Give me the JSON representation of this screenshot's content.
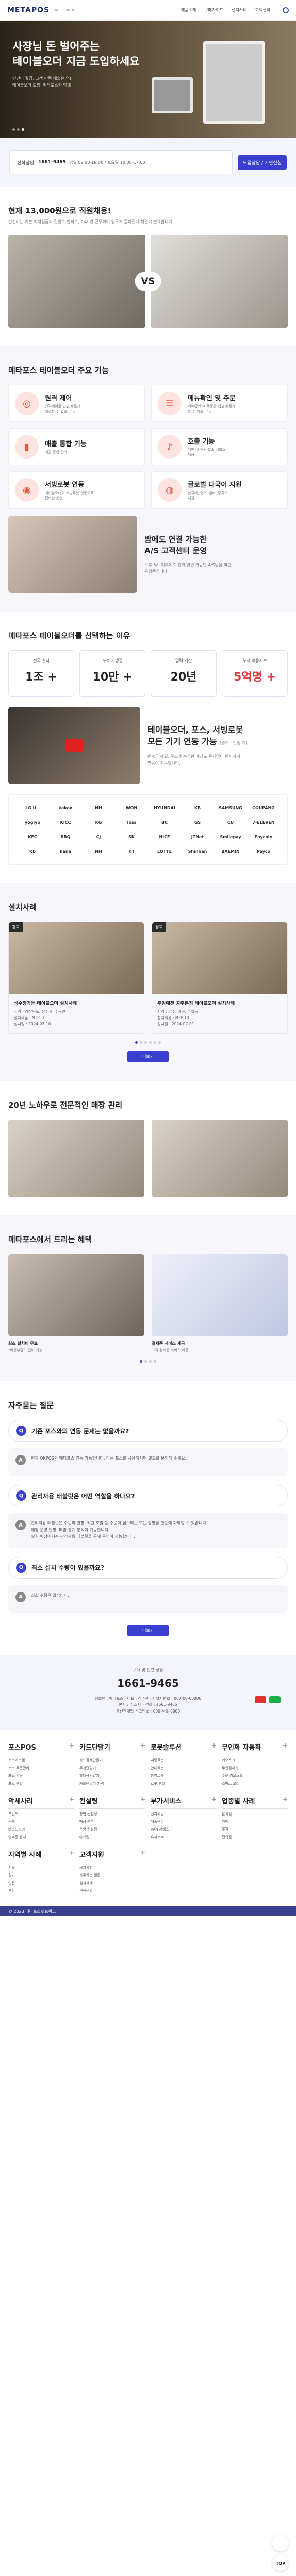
{
  "header": {
    "logo": "METAPOS",
    "logo_sub": "TABLE ORDER",
    "menu": [
      "제품소개",
      "구매가이드",
      "설치사례",
      "고객센터"
    ],
    "search_icon": "search-icon"
  },
  "hero": {
    "title": "사장님 돈 벌어주는\n테이블오더 지금 도입하세요",
    "desc": "인건비 절감, 고객 만족 매출은 업!\n테이블오더 도입, 메타포스와 함께"
  },
  "consult": {
    "label": "전화상담",
    "phone": "1661-9465",
    "hours": "평일 09:00-18:00 / 토요일 10:00-17:00",
    "button": "도입상담 / 시연신청"
  },
  "intro": {
    "title": "현재 13,000원으로 직원채용!",
    "sub": "인건비는 기본 최저임금의 절반도 안되고, 24시간 근무하며 업무가 틀려질때 해결이 필요합니다.",
    "vs": "VS"
  },
  "features": {
    "title": "메타포스 테이블오더 주요 기능",
    "items": [
      {
        "t": "원격 제어",
        "d": "원격제어로 쉽고 빠르게\n해결할 수 있습니다.",
        "icon": "remote-icon"
      },
      {
        "t": "메뉴확인 및 주문",
        "d": "메뉴확인 후 주문을 쉽고 빠르게\n할 수 있습니다.",
        "icon": "menu-icon"
      },
      {
        "t": "매출 통합 기능",
        "d": "매출 통합 관리",
        "icon": "chart-icon"
      },
      {
        "t": "호출 기능",
        "d": "메인 내 직원 호출 서비스\n제공",
        "icon": "bell-icon"
      },
      {
        "t": "서빙로봇 연동",
        "d": "테이블오더와 서빙로봇 연동으로\n편리한 운영",
        "icon": "robot-icon"
      },
      {
        "t": "글로벌 다국어 지원",
        "d": "한국어, 영어, 일어, 중국어\n지원",
        "icon": "globe-icon"
      }
    ],
    "as_title": "밤에도 연결 가능한\nA/S 고객센터 운영",
    "as_desc": "오후 6시 이후에도 전화 연결 가능한 A/S팀을 마련\n운영중입니다."
  },
  "reasons": {
    "title": "메타포스 테이블오더를 선택하는 이유",
    "items": [
      {
        "l": "전국 설치",
        "v": "1조 +",
        "red": false
      },
      {
        "l": "누적 가맹점",
        "v": "10만 +",
        "red": false
      },
      {
        "l": "업력 기간",
        "v": "20년",
        "red": false
      },
      {
        "l": "누적 이용자수",
        "v": "5억명 +",
        "red": true
      }
    ],
    "video_title": "테이블오더, 포스, 서빙로봇\n모든 기기 연동 가능",
    "video_title_small": "[출처 : 인업 기]",
    "video_desc": "원과금 해결, 구조가 복잡한 매장도 문제없이 완벽하게\n연동이 가능합니다."
  },
  "partners": [
    "LG U+",
    "kakao",
    "NH",
    "WON",
    "HYUNDAI",
    "KB",
    "SAMSUNG",
    "COUPANG",
    "yogiyo",
    "KICC",
    "KG",
    "Toss",
    "BC",
    "GS",
    "CU",
    "7-ELEVEN",
    "KFC",
    "BBQ",
    "CJ",
    "SK",
    "NICE",
    "JTNet",
    "Smilepay",
    "Paycoin",
    "Kb",
    "hana",
    "NH",
    "KT",
    "LOTTE",
    "Shinhan",
    "BAEMIN",
    "Payco"
  ],
  "install": {
    "title": "설치사례",
    "cards": [
      {
        "tag": "경북",
        "name": "생수장가든 테이블오더 설치사례",
        "info": "지역 : 경상북도, 상주시, 수동면\n설치제품 : NTP-10\n설치일 : 2024-07-10"
      },
      {
        "tag": "경북",
        "name": "두암예천 공주본점 테이블오더 설치사례",
        "info": "지역 : 경주, 예구, 수입동\n설치제품 : NTP-10\n설치일 : 2024-07-01"
      }
    ],
    "more": "더보기"
  },
  "expert": {
    "title": "20년 노하우로 전문적인 매장 관리"
  },
  "benefit": {
    "title": "메타포스에서 드리는 혜택",
    "items": [
      {
        "n": "최초 설치비 무료",
        "d": "*비용부담이 없이 기능"
      },
      {
        "n": "결제준 서비스 제공",
        "d": "고객 결제한 서비스 제공"
      }
    ]
  },
  "faq": {
    "title": "자주묻는 질문",
    "items": [
      {
        "q": "기존 포스와의 연동 문제는 없을까요?",
        "a": "현재 OKPOS와 메타포스 연동 가능합니다. 다른 포스를 사용하시면 별도로 문의해 주세요."
      },
      {
        "q": "관리자용 태블릿은 어떤 역할을 하나요?",
        "a": "관리자용 태블릿은 주문의 현황, 직원 호출 등 주문이 접수되는 모든 상황을 한눈에 파악할 수 있습니다.\n매장 운영 현황, 매출 통계 분석이 가능합니다.\n설치 매장에서는 관리자용 태블릿을 통해 운영이 가능합니다."
      },
      {
        "q": "최소 설치 수량이 있을까요?",
        "a": "최소 수량은 없습니다."
      }
    ],
    "more": "더보기"
  },
  "info": {
    "label": "구매 및 관련 상담",
    "tel": "1661-9465",
    "company": "상호명 : 메타포스 · 대표 : 김주한 · 사업자번호 : 000-00-00000\n본사 : 주소 내 · 전화 : 1661-9465\n통신판매업 신고번호 : 000-서울-0000"
  },
  "sitemap": [
    {
      "h": "포스POS",
      "items": [
        "포스시스템",
        "포스 주문관리",
        "포스 연동",
        "포스 렌탈"
      ]
    },
    {
      "h": "카드단말기",
      "items": [
        "카드결제단말기",
        "무선단말기",
        "휴대용단말기",
        "카드단말기 가격"
      ]
    },
    {
      "h": "로봇솔루션",
      "items": [
        "서빙로봇",
        "안내로봇",
        "방역로봇",
        "로봇 렌탈"
      ]
    },
    {
      "h": "무인화 자동화",
      "items": [
        "키오스크",
        "무인결제기",
        "주문 키오스크",
        "스마트 오더"
      ]
    },
    {
      "h": "악세사리",
      "items": [
        "프린터",
        "돈통",
        "바코드리더",
        "영수증 용지"
      ]
    },
    {
      "h": "컨설팅",
      "items": [
        "창업 컨설팅",
        "매장 분석",
        "운영 컨설팅",
        "마케팅"
      ]
    },
    {
      "h": "부가서비스",
      "items": [
        "전자세금",
        "매출관리",
        "VAN 서비스",
        "유지보수"
      ]
    },
    {
      "h": "업종별 사례",
      "items": [
        "음식점",
        "카페",
        "주점",
        "편의점"
      ]
    },
    {
      "h": "지역별 사례",
      "items": [
        "서울",
        "경기",
        "인천",
        "부산"
      ]
    },
    {
      "h": "고객지원",
      "items": [
        "공지사항",
        "자주하는 질문",
        "설치사례",
        "견적문의"
      ]
    }
  ],
  "footer": {
    "copy": "© 2023 메타포스넷트워크"
  },
  "float": {
    "top": "TOP"
  }
}
